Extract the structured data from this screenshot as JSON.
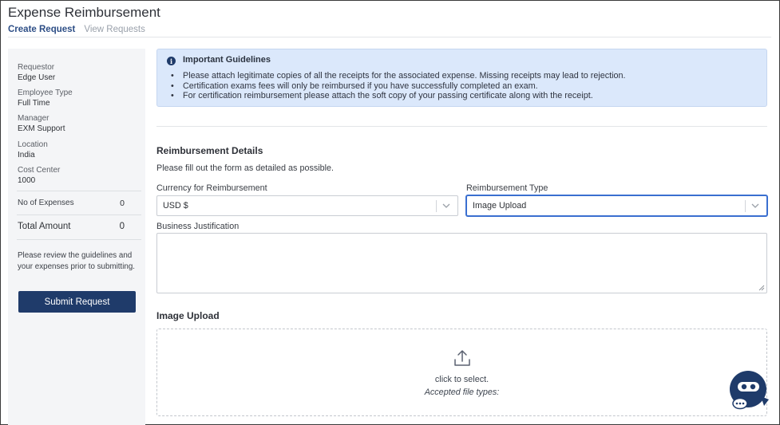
{
  "page": {
    "title": "Expense Reimbursement"
  },
  "tabs": [
    {
      "label": "Create Request",
      "active": true
    },
    {
      "label": "View Requests",
      "active": false
    }
  ],
  "sidebar": {
    "fields": [
      {
        "label": "Requestor",
        "value": "Edge User"
      },
      {
        "label": "Employee Type",
        "value": "Full Time"
      },
      {
        "label": "Manager",
        "value": "EXM Support"
      },
      {
        "label": "Location",
        "value": "India"
      },
      {
        "label": "Cost Center",
        "value": "1000"
      }
    ],
    "expenses_label": "No of Expenses",
    "expenses_value": "0",
    "total_label": "Total Amount",
    "total_value": "0",
    "note": "Please review the guidelines and your expenses prior to submitting.",
    "submit_label": "Submit Request"
  },
  "guidelines": {
    "icon": "info-icon",
    "title": "Important Guidelines",
    "items": [
      "Please attach legitimate copies of all the receipts for the associated expense. Missing receipts may lead to rejection.",
      "Certification exams fees will only be reimbursed if you have successfully completed an exam.",
      "For certification reimbursement please attach the soft copy of your passing certificate along with the receipt."
    ]
  },
  "details": {
    "title": "Reimbursement Details",
    "subtitle": "Please fill out the form as detailed as possible.",
    "currency_label": "Currency for Reimbursement",
    "currency_value": "USD $",
    "type_label": "Reimbursement Type",
    "type_value": "Image Upload",
    "justification_label": "Business Justification",
    "justification_value": ""
  },
  "upload": {
    "title": "Image Upload",
    "icon": "upload-icon",
    "select_text": "click to select.",
    "types_text": "Accepted file types:"
  },
  "colors": {
    "accent": "#2d4e86",
    "button": "#1f3b6a",
    "focus": "#3a6fd0",
    "guide_bg": "#dbe8fb"
  }
}
